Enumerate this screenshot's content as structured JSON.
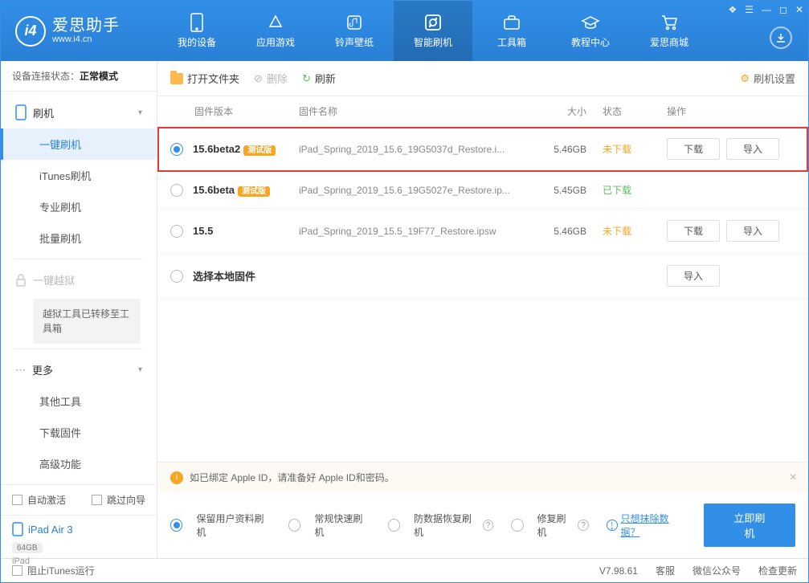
{
  "app": {
    "title": "爱思助手",
    "url": "www.i4.cn"
  },
  "window_ctrls": [
    "❖",
    "☰",
    "—",
    "◻",
    "✕"
  ],
  "nav": [
    {
      "label": "我的设备"
    },
    {
      "label": "应用游戏"
    },
    {
      "label": "铃声壁纸"
    },
    {
      "label": "智能刷机",
      "active": true
    },
    {
      "label": "工具箱"
    },
    {
      "label": "教程中心"
    },
    {
      "label": "爱思商城"
    }
  ],
  "conn": {
    "label": "设备连接状态：",
    "value": "正常模式"
  },
  "sidebar": {
    "flash": {
      "parent": "刷机",
      "items": [
        "一键刷机",
        "iTunes刷机",
        "专业刷机",
        "批量刷机"
      ]
    },
    "jailbreak": {
      "parent": "一键越狱",
      "note": "越狱工具已转移至工具箱"
    },
    "more": {
      "parent": "更多",
      "items": [
        "其他工具",
        "下载固件",
        "高级功能"
      ]
    },
    "auto_activate": "自动激活",
    "skip_guide": "跳过向导"
  },
  "device": {
    "name": "iPad Air 3",
    "storage": "64GB",
    "type": "iPad"
  },
  "toolbar": {
    "open": "打开文件夹",
    "delete": "删除",
    "refresh": "刷新",
    "settings": "刷机设置"
  },
  "columns": {
    "version": "固件版本",
    "name": "固件名称",
    "size": "大小",
    "status": "状态",
    "action": "操作"
  },
  "firmware": [
    {
      "selected": true,
      "version": "15.6beta2",
      "beta": "测试版",
      "name": "iPad_Spring_2019_15.6_19G5037d_Restore.i...",
      "size": "5.46GB",
      "status": "未下载",
      "status_cls": "nd",
      "download": "下载",
      "import": "导入",
      "hl": true
    },
    {
      "selected": false,
      "version": "15.6beta",
      "beta": "测试版",
      "name": "iPad_Spring_2019_15.6_19G5027e_Restore.ip...",
      "size": "5.45GB",
      "status": "已下载",
      "status_cls": "dd"
    },
    {
      "selected": false,
      "version": "15.5",
      "beta": "",
      "name": "iPad_Spring_2019_15.5_19F77_Restore.ipsw",
      "size": "5.46GB",
      "status": "未下载",
      "status_cls": "nd",
      "download": "下载",
      "import": "导入"
    },
    {
      "selected": false,
      "version": "选择本地固件",
      "beta": "",
      "name": "",
      "size": "",
      "status": "",
      "status_cls": "",
      "import": "导入"
    }
  ],
  "alert": "如已绑定 Apple ID，请准备好 Apple ID和密码。",
  "flash_options": [
    "保留用户资料刷机",
    "常规快速刷机",
    "防数据恢复刷机",
    "修复刷机"
  ],
  "erase_link": "只想抹除数据？",
  "flash_now": "立即刷机",
  "status": {
    "block_itunes": "阻止iTunes运行",
    "version": "V7.98.61",
    "cs": "客服",
    "wechat": "微信公众号",
    "update": "检查更新"
  }
}
